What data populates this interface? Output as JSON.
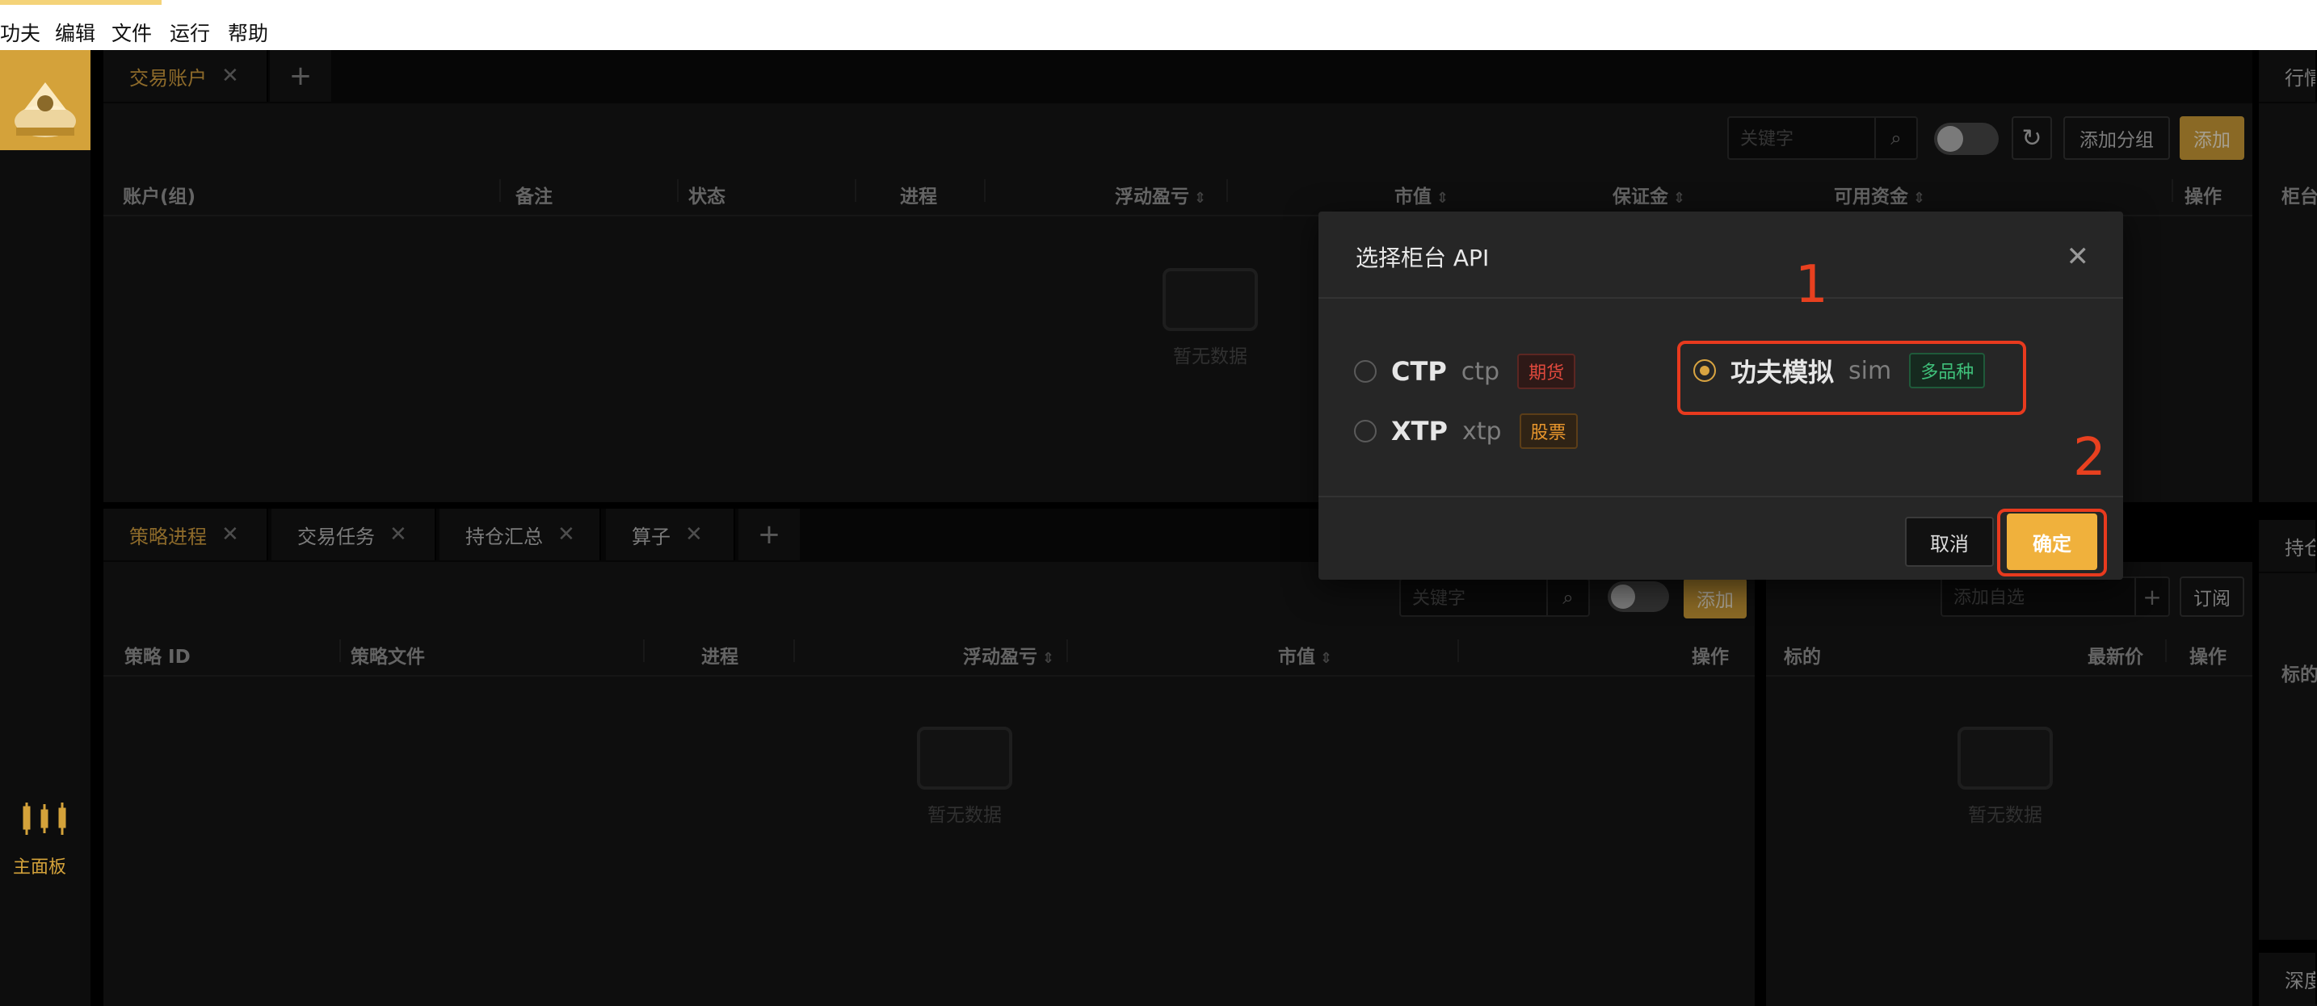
{
  "menu": [
    "功夫",
    "编辑",
    "文件",
    "运行",
    "帮助"
  ],
  "sidebar": {
    "dashboard_label": "主面板"
  },
  "top_panel": {
    "tabs": [
      {
        "label": "交易账户"
      }
    ],
    "search_placeholder": "关键字",
    "add_group_label": "添加分组",
    "add_label": "添加",
    "columns": [
      "账户(组)",
      "备注",
      "状态",
      "进程",
      "浮动盈亏",
      "市值",
      "保证金",
      "可用资金",
      "操作"
    ],
    "empty_text": "暂无数据"
  },
  "right_top_panel": {
    "tab_label": "行情",
    "column_label": "柜台"
  },
  "right_mid_panel": {
    "tab_label": "持仓",
    "column_label": "标的"
  },
  "right_bottom_panel": {
    "tab_label": "深度"
  },
  "bottom_left_panel": {
    "tabs": [
      {
        "label": "策略进程"
      },
      {
        "label": "交易任务"
      },
      {
        "label": "持仓汇总"
      },
      {
        "label": "算子"
      }
    ],
    "search_placeholder": "关键字",
    "add_label": "添加",
    "columns": [
      "策略 ID",
      "策略文件",
      "进程",
      "浮动盈亏",
      "市值",
      "操作"
    ],
    "empty_text": "暂无数据"
  },
  "bottom_right_panel": {
    "search_placeholder": "添加自选",
    "subscribe_label": "订阅",
    "columns": [
      "标的",
      "最新价",
      "操作"
    ],
    "empty_text": "暂无数据"
  },
  "dialog": {
    "title": "选择柜台 API",
    "options": [
      {
        "name": "CTP",
        "code": "ctp",
        "tag": "期货",
        "tag_color": "#e0493d",
        "selected": false
      },
      {
        "name": "XTP",
        "code": "xtp",
        "tag": "股票",
        "tag_color": "#e8962d",
        "selected": false
      },
      {
        "name": "功夫模拟",
        "code": "sim",
        "tag": "多品种",
        "tag_color": "#3fc07a",
        "selected": true
      }
    ],
    "cancel_label": "取消",
    "ok_label": "确定"
  },
  "annotations": {
    "first": "1",
    "second": "2"
  },
  "colors": {
    "accent": "#d4a23a",
    "annotation": "#e83a1e"
  }
}
